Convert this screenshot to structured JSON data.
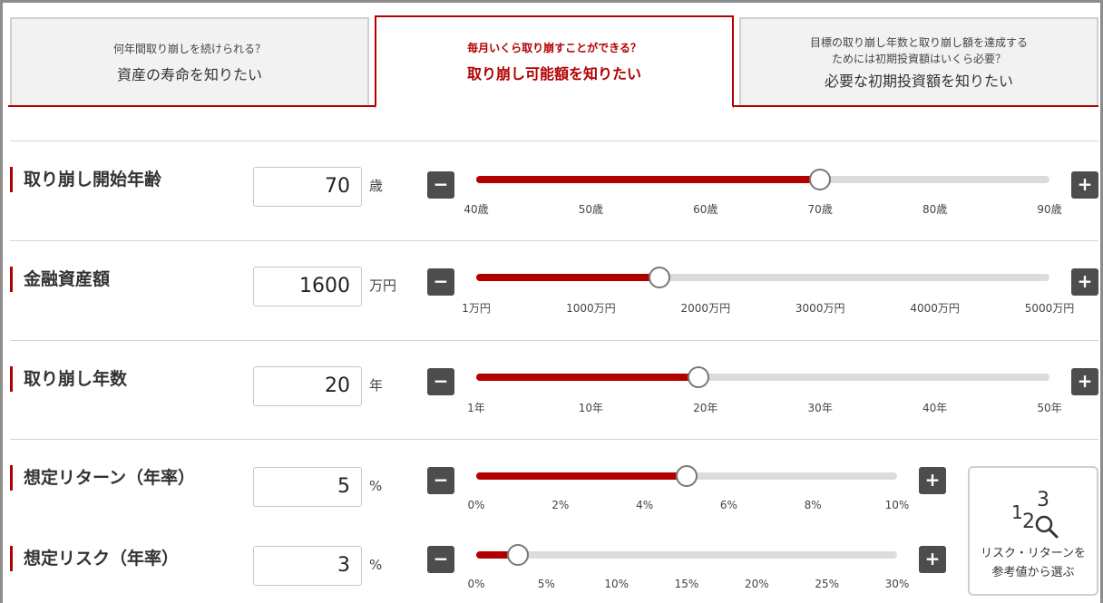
{
  "tabs": [
    {
      "sub": "何年間取り崩しを続けられる？",
      "main": "資産の寿命を知りたい"
    },
    {
      "sub": "毎月いくら取り崩すことができる？",
      "main": "取り崩し可能額を知りたい"
    },
    {
      "sub1": "目標の取り崩し年数と取り崩し額を達成する",
      "sub2": "ためには初期投資額はいくら必要？",
      "main": "必要な初期投資額を知りたい"
    }
  ],
  "rows": [
    {
      "label": "取り崩し開始年齢",
      "value": "70",
      "unit": "歳",
      "fraction": 0.6,
      "ticks": [
        "40歳",
        "50歳",
        "60歳",
        "70歳",
        "80歳",
        "90歳"
      ]
    },
    {
      "label": "金融資産額",
      "value": "1600",
      "unit": "万円",
      "fraction": 0.32,
      "ticks": [
        "1万円",
        "1000万円",
        "2000万円",
        "3000万円",
        "4000万円",
        "5000万円"
      ]
    },
    {
      "label": "取り崩し年数",
      "value": "20",
      "unit": "年",
      "fraction": 0.388,
      "ticks": [
        "1年",
        "10年",
        "20年",
        "30年",
        "40年",
        "50年"
      ]
    },
    {
      "label": "想定リターン（年率）",
      "value": "5",
      "unit": "%",
      "fraction": 0.5,
      "ticks": [
        "0%",
        "2%",
        "4%",
        "6%",
        "8%",
        "10%"
      ]
    },
    {
      "label": "想定リスク（年率）",
      "value": "3",
      "unit": "%",
      "fraction": 0.1,
      "ticks": [
        "0%",
        "5%",
        "10%",
        "15%",
        "20%",
        "25%",
        "30%"
      ]
    }
  ],
  "buttons": {
    "minus": "−",
    "plus": "+"
  },
  "reference": {
    "icon_text_1": "1",
    "icon_text_2": "2",
    "icon_text_3": "3",
    "line1": "リスク・リターンを",
    "line2": "参考値から選ぶ",
    "icon": "magnifier-icon"
  },
  "colors": {
    "accent": "#b20000",
    "track": "#dcdcdc",
    "button": "#4d4d4d"
  }
}
